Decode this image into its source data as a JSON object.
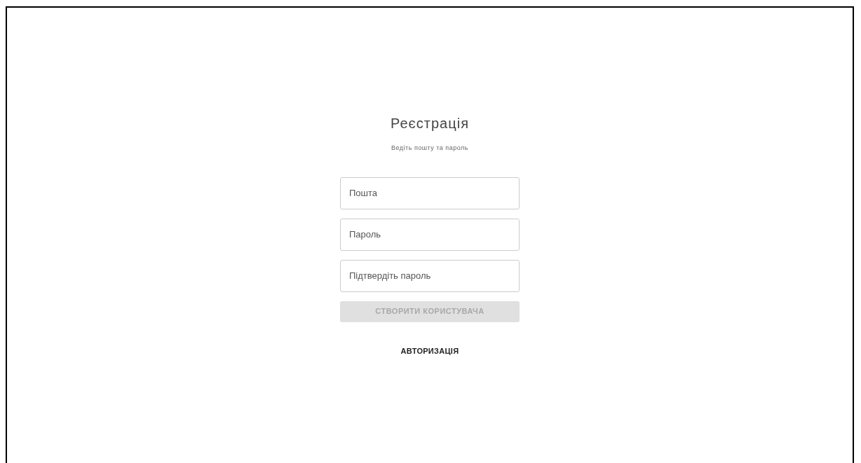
{
  "title": "Реєстрація",
  "subtitle": "Ведіть пошту та пароль",
  "fields": [
    {
      "placeholder": "Пошта"
    },
    {
      "placeholder": "Пароль"
    },
    {
      "placeholder": "Підтвердіть пароль"
    }
  ],
  "submit": {
    "label": "СТВОРИТИ КОРИСТУВАЧА",
    "disabled": true
  },
  "link": "АВТОРИЗАЦІЯ"
}
